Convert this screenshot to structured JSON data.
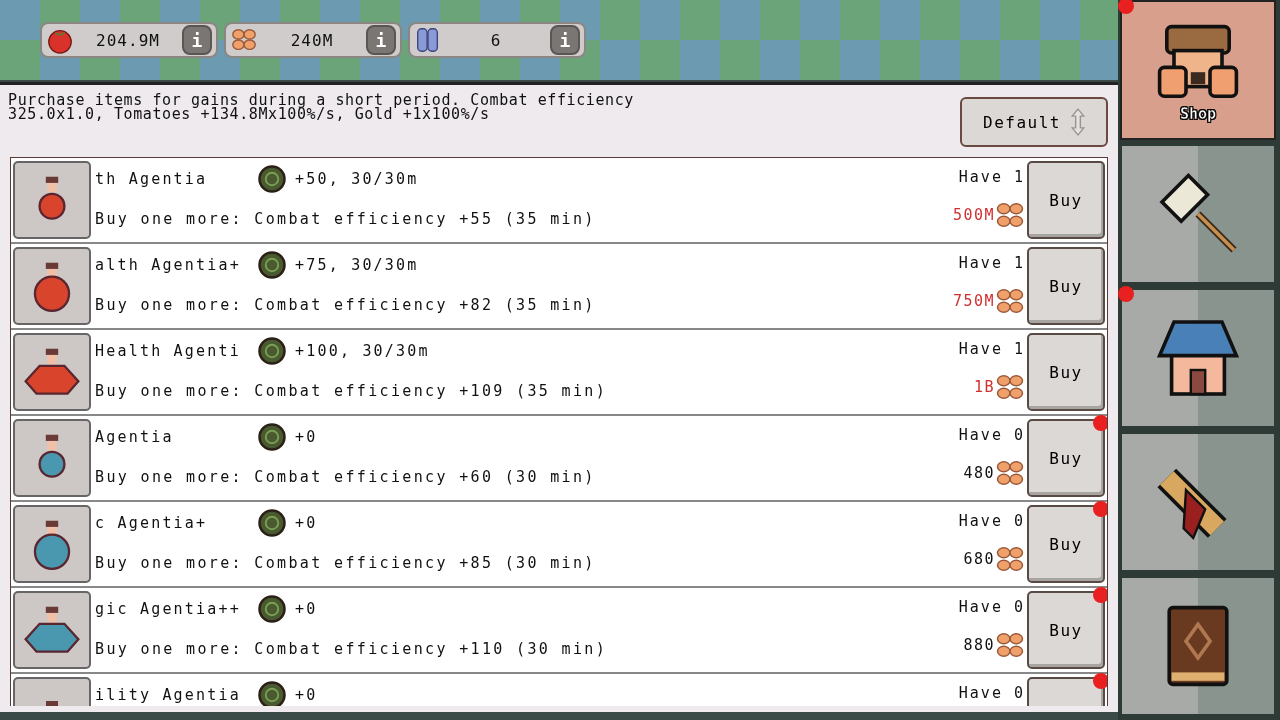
{
  "resources": [
    {
      "kind": "tomato",
      "value": "204.9M",
      "info": "i"
    },
    {
      "kind": "coins",
      "value": "240M",
      "info": "i"
    },
    {
      "kind": "crystal",
      "value": "6",
      "info": "i"
    }
  ],
  "description": "Purchase items for gains during a short period. Combat efficiency 325.0x1.0, Tomatoes +134.8Mx100%/s, Gold +1x100%/s",
  "sort_button": {
    "label": "Default"
  },
  "items": [
    {
      "name": "th Agentia",
      "effect": "+50, 30/30m",
      "info": "Buy one more: Combat efficiency +55 (35 min)",
      "have": "Have 1",
      "price": "500M",
      "affordable": false,
      "buy": "Buy",
      "alert": false,
      "color": "#d8452c",
      "kind": "small"
    },
    {
      "name": "alth Agentia+",
      "effect": "+75, 30/30m",
      "info": "Buy one more: Combat efficiency +82 (35 min)",
      "have": "Have 1",
      "price": "750M",
      "affordable": false,
      "buy": "Buy",
      "alert": false,
      "color": "#d8452c",
      "kind": "round"
    },
    {
      "name": "Health Agenti",
      "effect": "+100, 30/30m",
      "info": "Buy one more: Combat efficiency +109 (35 min)",
      "have": "Have 1",
      "price": "1B",
      "affordable": false,
      "buy": "Buy",
      "alert": false,
      "color": "#d8452c",
      "kind": "wide"
    },
    {
      "name": "Agentia",
      "effect": "+0",
      "info": "Buy one more: Combat efficiency +60 (30 min)",
      "have": "Have 0",
      "price": "480",
      "affordable": true,
      "buy": "Buy",
      "alert": true,
      "color": "#4a98b0",
      "kind": "small"
    },
    {
      "name": "c Agentia+",
      "effect": "+0",
      "info": "Buy one more: Combat efficiency +85 (30 min)",
      "have": "Have 0",
      "price": "680",
      "affordable": true,
      "buy": "Buy",
      "alert": true,
      "color": "#4a98b0",
      "kind": "round"
    },
    {
      "name": "gic Agentia++",
      "effect": "+0",
      "info": "Buy one more: Combat efficiency +110 (30 min)",
      "have": "Have 0",
      "price": "880",
      "affordable": true,
      "buy": "Buy",
      "alert": true,
      "color": "#4a98b0",
      "kind": "wide"
    },
    {
      "name": "ility Agentia",
      "effect": "+0",
      "have": "Have 0",
      "alert": true,
      "kind": "cap"
    }
  ],
  "tabs": [
    {
      "kind": "shop",
      "label": "Shop",
      "selected": true,
      "alert": true
    },
    {
      "kind": "hammer",
      "selected": false,
      "alert": false
    },
    {
      "kind": "house",
      "selected": false,
      "alert": true
    },
    {
      "kind": "scroll",
      "selected": false,
      "alert": false
    },
    {
      "kind": "book",
      "selected": false,
      "alert": false
    }
  ]
}
